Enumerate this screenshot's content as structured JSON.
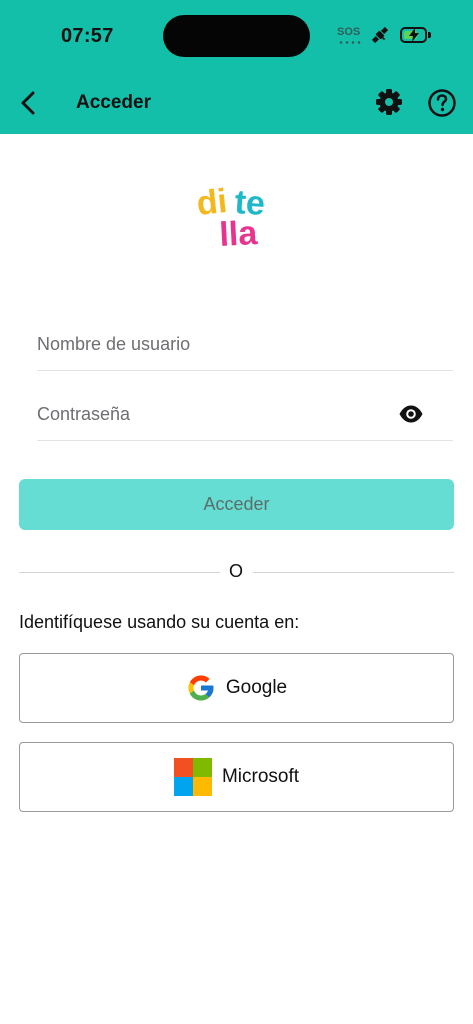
{
  "status_bar": {
    "time": "07:57",
    "sos": "SOS",
    "icons": [
      "satellite-icon",
      "battery-charging-icon"
    ]
  },
  "header": {
    "title": "Acceder",
    "icons": [
      "back-arrow-icon",
      "gear-icon",
      "help-icon"
    ]
  },
  "logo": {
    "lines": [
      "di",
      "te",
      "lla"
    ],
    "colors": [
      "#f5b81c",
      "#1fb8c9",
      "#e8348f"
    ]
  },
  "form": {
    "username_placeholder": "Nombre de usuario",
    "password_placeholder": "Contraseña",
    "login_label": "Acceder"
  },
  "divider": {
    "text": "O"
  },
  "alt_login": {
    "label": "Identifíquese usando su cuenta en:",
    "google_label": "Google",
    "microsoft_label": "Microsoft"
  },
  "colors": {
    "accent": "#14bfaa",
    "button": "#66ddd3"
  }
}
